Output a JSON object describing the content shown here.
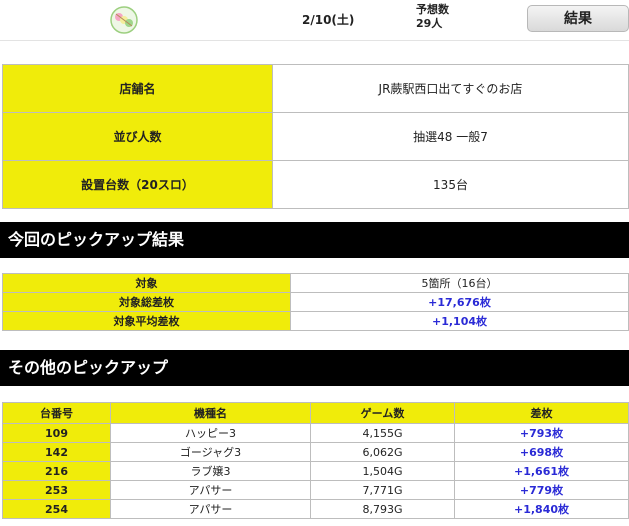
{
  "header": {
    "date": "2/10(土)",
    "forecast_label": "予想数",
    "forecast_value": "29人",
    "result_button": "結果"
  },
  "shop_info": [
    {
      "label": "店舗名",
      "value": "JR蕨駅西口出てすぐのお店"
    },
    {
      "label": "並び人数",
      "value": "抽選48 一般7"
    },
    {
      "label": "設置台数（20スロ）",
      "value": "135台"
    }
  ],
  "pickup_result": {
    "title": "今回のピックアップ結果",
    "rows": [
      {
        "label": "対象",
        "value": "5箇所（16台）"
      },
      {
        "label": "対象総差枚",
        "value": "+17,676枚"
      },
      {
        "label": "対象平均差枚",
        "value": "+1,104枚"
      }
    ]
  },
  "other_pickup": {
    "title": "その他のピックアップ",
    "columns": [
      "台番号",
      "機種名",
      "ゲーム数",
      "差枚"
    ],
    "rows": [
      {
        "no": "109",
        "model": "ハッピー3",
        "games": "4,155G",
        "diff": "+793枚"
      },
      {
        "no": "142",
        "model": "ゴージャグ3",
        "games": "6,062G",
        "diff": "+698枚"
      },
      {
        "no": "216",
        "model": "ラブ嬢3",
        "games": "1,504G",
        "diff": "+1,661枚"
      },
      {
        "no": "253",
        "model": "アパサー",
        "games": "7,771G",
        "diff": "+779枚"
      },
      {
        "no": "254",
        "model": "アパサー",
        "games": "8,793G",
        "diff": "+1,840枚"
      }
    ]
  },
  "colors": {
    "highlight": "#f0ec0a",
    "positive": "#2a2ad6",
    "band": "#000000"
  },
  "icons": {
    "logo": "dango-logo-icon"
  }
}
